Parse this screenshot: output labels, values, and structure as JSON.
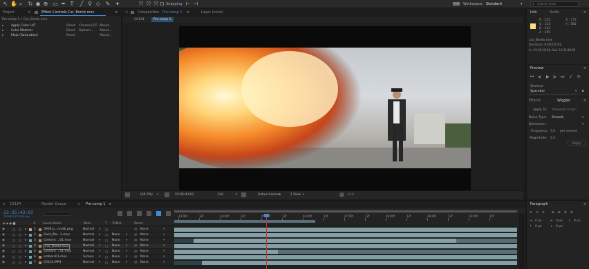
{
  "toolbar": {
    "snapping": "Snapping",
    "workspace_label": "Workspace:",
    "workspace_value": "Standard",
    "search_placeholder": "Search Help"
  },
  "project_panel": {
    "tabs": [
      "Project",
      "Effect Controls Car_Bomb.mov"
    ],
    "subtitle": "Pre-comp 1 • Car_Bomb.mov",
    "effects": [
      {
        "name": "Apply Color LUT",
        "reset": "Reset",
        "extra": "Choose LUT...",
        "about": "About..."
      },
      {
        "name": "Color Matcher",
        "reset": "Reset",
        "extra": "Options...",
        "about": "About..."
      },
      {
        "name": "Mojo (Saturation)",
        "reset": "Reset",
        "extra": "",
        "about": "About..."
      }
    ]
  },
  "comp_panel": {
    "tab_label": "Composition",
    "tab_value": "Pre-comp 1",
    "layer_tab": "Layer (none)",
    "breadcrumbs": [
      "C0124",
      "Pre-comp 1"
    ],
    "bottom_bar": {
      "zoom": "(66.7%)",
      "timecode": "23:35:43:03",
      "resolution": "Full",
      "camera": "Active Camera",
      "view": "1 View",
      "exposure": "+0.0"
    }
  },
  "info_panel": {
    "tabs": [
      "Info",
      "Audio"
    ],
    "r": "R : 252",
    "g": "G : 223",
    "b": "B : 124",
    "a": "A : 255",
    "x": "X : 777",
    "y": "Y : 381",
    "file_name": "Car_Bomb.mov",
    "duration": "Duration: 0:00:07:02",
    "in_out": "In: 23:35:42:04, Out: 23:35:49:05"
  },
  "preview_panel": {
    "title": "Preview"
  },
  "shortcut_panel": {
    "label": "Shortcut",
    "value": "Spacebar"
  },
  "effects_panel": {
    "title": "Effects",
    "wiggler_title": "Wiggler",
    "apply_to_label": "Apply To:",
    "apply_to_value": "Temporal Graph",
    "noise_type_label": "Noise Type:",
    "noise_type_value": "Smooth",
    "dimension_label": "Dimension:",
    "frequency_label": "Frequency:",
    "frequency_value": "5.0",
    "frequency_unit": "per second",
    "magnitude_label": "Magnitude:",
    "magnitude_value": "1.0",
    "apply_button": "Apply"
  },
  "paragraph_panel": {
    "title": "Paragraph",
    "v1": "0 px",
    "v2": "0 px",
    "v3": "0 px",
    "v4": "0 px",
    "v5": "0 px"
  },
  "timeline": {
    "tabs": [
      "C0124",
      "Render Queue",
      "Pre-comp 1"
    ],
    "timecode": "23:35:43:03",
    "frame_info": "2039323 (23.976 fps)",
    "columns": [
      "#",
      "Source Name",
      "Mode",
      "T",
      "TrkMat",
      "Parent"
    ],
    "layers": [
      {
        "num": "1",
        "name": "5900 p...rvsdk.png",
        "mode": "Normal",
        "trkmat": "",
        "parent": "None"
      },
      {
        "num": "2",
        "name": "Dust_Wa...3.mov",
        "mode": "Normal",
        "trkmat": "None",
        "parent": "None"
      },
      {
        "num": "3",
        "name": "Cement ...01.mov",
        "mode": "Normal",
        "trkmat": "None",
        "parent": "None"
      },
      {
        "num": "4",
        "name": "Car_Bomb.mov",
        "mode": "Normal",
        "trkmat": "None",
        "parent": "None"
      },
      {
        "num": "5",
        "name": "Cement ...01.mov",
        "mode": "Normal",
        "trkmat": "None",
        "parent": "None"
      },
      {
        "num": "6",
        "name": "embers01.mov",
        "mode": "Screen",
        "trkmat": "None",
        "parent": "None"
      },
      {
        "num": "7",
        "name": "C0124.MP4",
        "mode": "Normal",
        "trkmat": "None",
        "parent": "None"
      }
    ],
    "ruler_labels": [
      "43:00f",
      "12f",
      "44:00f",
      "12f",
      "45:00f",
      "12f",
      "46:00f",
      "12f",
      "47:00f",
      "12f",
      "48:00f",
      "12f",
      "49:00f",
      "12f",
      "50:00f",
      "12f"
    ]
  },
  "colors": {
    "accent_blue": "#3e8ad6",
    "playhead": "#c0392b",
    "layer_colors": [
      "#c9a77b",
      "#6fa3a8",
      "#6fa3a8",
      "#6fa3a8",
      "#6fa3a8",
      "#6fa3a8",
      "#6fa3a8"
    ]
  }
}
